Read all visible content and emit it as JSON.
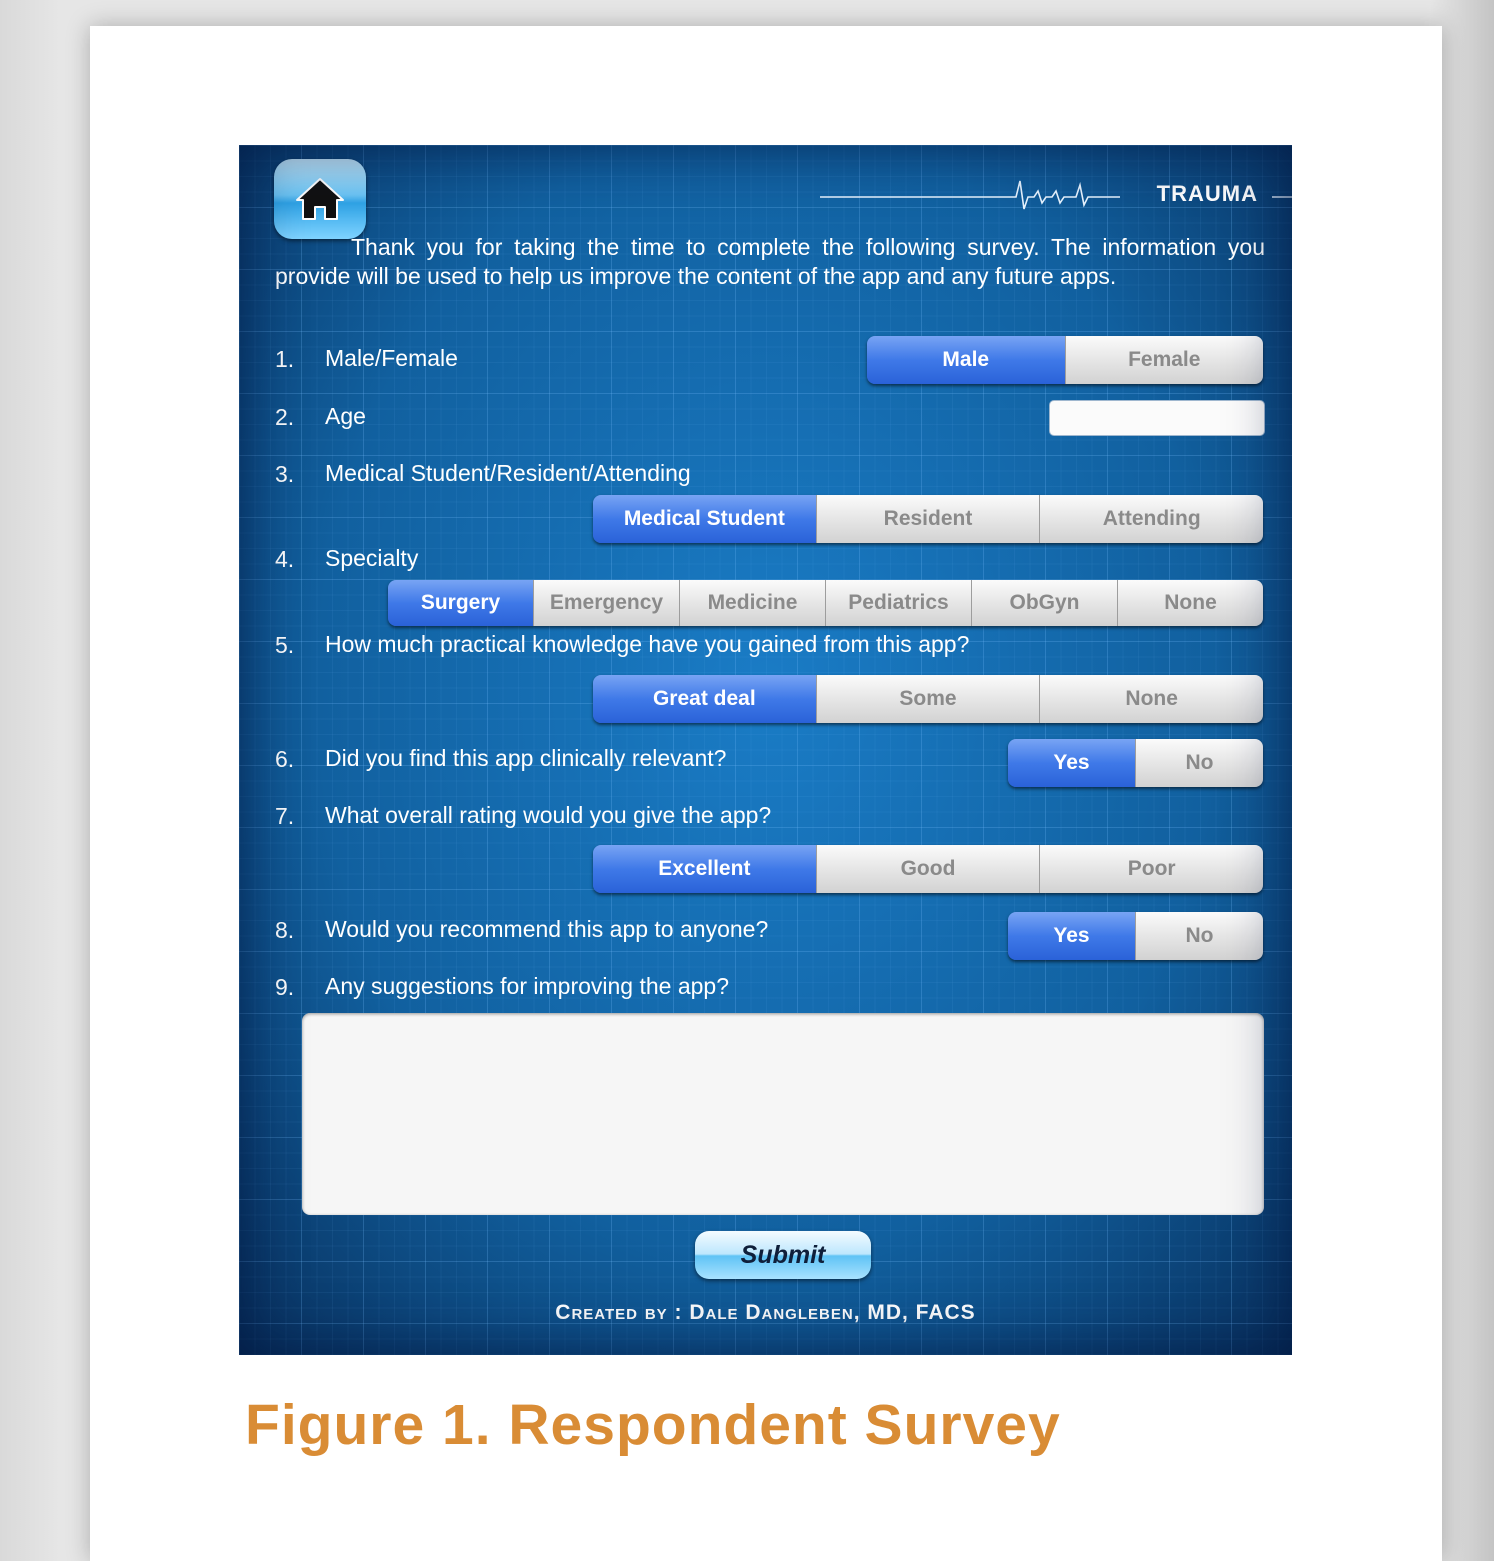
{
  "header": {
    "brand": "TRAUMA"
  },
  "intro": "Thank you for taking the time to complete the following survey. The information you provide will be used to help us improve the content of the app and any future apps.",
  "questions": [
    {
      "num": "1.",
      "text": "Male/Female",
      "options": [
        "Male",
        "Female"
      ],
      "selected": "Male"
    },
    {
      "num": "2.",
      "text": "Age",
      "value": ""
    },
    {
      "num": "3.",
      "text": "Medical Student/Resident/Attending",
      "options": [
        "Medical Student",
        "Resident",
        "Attending"
      ],
      "selected": "Medical Student"
    },
    {
      "num": "4.",
      "text": "Specialty",
      "options": [
        "Surgery",
        "Emergency",
        "Medicine",
        "Pediatrics",
        "ObGyn",
        "None"
      ],
      "selected": "Surgery"
    },
    {
      "num": "5.",
      "text": "How much practical knowledge have you gained from this app?",
      "options": [
        "Great deal",
        "Some",
        "None"
      ],
      "selected": "Great deal"
    },
    {
      "num": "6.",
      "text": "Did you find this app clinically relevant?",
      "options": [
        "Yes",
        "No"
      ],
      "selected": "Yes"
    },
    {
      "num": "7.",
      "text": "What overall rating would you give the app?",
      "options": [
        "Excellent",
        "Good",
        "Poor"
      ],
      "selected": "Excellent"
    },
    {
      "num": "8.",
      "text": "Would you recommend this app to anyone?",
      "options": [
        "Yes",
        "No"
      ],
      "selected": "Yes"
    },
    {
      "num": "9.",
      "text": "Any suggestions for improving the app?",
      "value": ""
    }
  ],
  "submit_label": "Submit",
  "credit": "Created by : Dale Dangleben, MD, FACS",
  "caption": "Figure 1. Respondent Survey",
  "colors": {
    "background_blue": "#1468ad",
    "selected_blue": "#3f79e8",
    "caption_orange": "#d98c35"
  },
  "icons": {
    "home": "home-icon",
    "ecg": "heartbeat-line-icon"
  }
}
